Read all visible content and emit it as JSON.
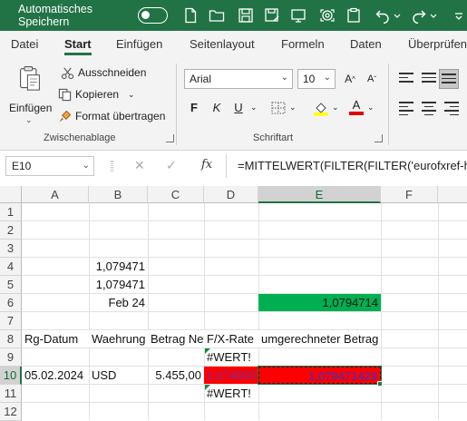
{
  "titlebar": {
    "autosave_label": "Automatisches Speichern"
  },
  "tabs": [
    "Datei",
    "Start",
    "Einfügen",
    "Seitenlayout",
    "Formeln",
    "Daten",
    "Überprüfen"
  ],
  "ribbon": {
    "paste_label": "Einfügen",
    "cut_label": "Ausschneiden",
    "copy_label": "Kopieren",
    "format_painter_label": "Format übertragen",
    "clipboard_group": "Zwischenablage",
    "font_name": "Arial",
    "font_size": "10",
    "bold": "F",
    "italic": "K",
    "underline": "U",
    "font_group": "Schriftart"
  },
  "formula_bar": {
    "name_box": "E10",
    "fx": "fx",
    "formula": "=MITTELWERT(FILTER(FILTER('eurofxref-hi"
  },
  "columns": [
    "A",
    "B",
    "C",
    "D",
    "E",
    "F"
  ],
  "rows": [
    "1",
    "2",
    "3",
    "4",
    "5",
    "6",
    "7",
    "8",
    "9",
    "10",
    "11",
    "12"
  ],
  "cells": {
    "B4": "1,079471",
    "B5": "1,079471",
    "B6": "Feb 24",
    "E6": "1,0794714",
    "A8": "Rg-Datum",
    "B8": "Waehrung",
    "C8": "Betrag Netto",
    "D8": "F/X-Rate",
    "E8": "umgerechneter Betrag",
    "D9": "#WERT!",
    "A10": "05.02.2024",
    "B10": "USD",
    "C10": "5.455,00",
    "D10": "1,074600",
    "E10": "1,079471429",
    "D11": "#WERT!"
  },
  "colors": {
    "accent": "#217346",
    "e6_fill": "#00b050",
    "red_fill": "#ff0000",
    "d10_text": "#7030a0",
    "e10_text": "#3333cc"
  }
}
